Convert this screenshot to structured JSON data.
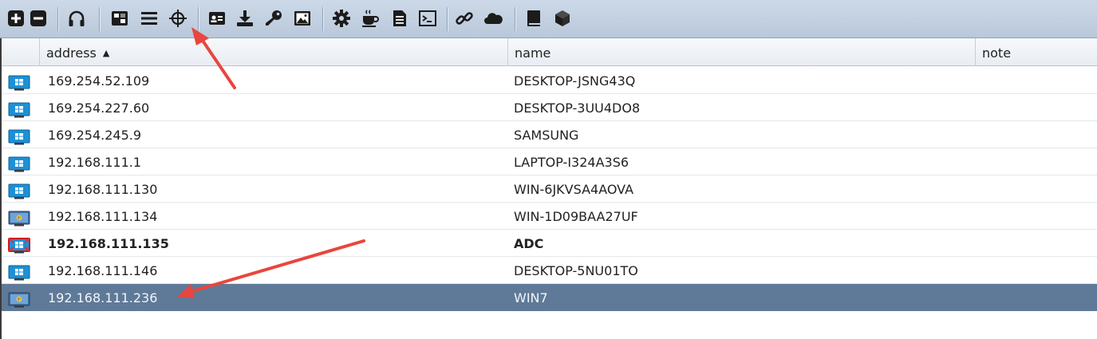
{
  "toolbar": {
    "buttons": [
      {
        "icon": "add-icon"
      },
      {
        "icon": "remove-icon"
      },
      {
        "icon": "headphones-icon"
      },
      {
        "icon": "pivot-graph-icon"
      },
      {
        "icon": "list-icon"
      },
      {
        "icon": "crosshair-icon"
      },
      {
        "icon": "credentials-icon"
      },
      {
        "icon": "download-icon"
      },
      {
        "icon": "key-icon"
      },
      {
        "icon": "image-icon"
      },
      {
        "icon": "gear-icon"
      },
      {
        "icon": "coffee-icon"
      },
      {
        "icon": "document-icon"
      },
      {
        "icon": "terminal-icon"
      },
      {
        "icon": "link-icon"
      },
      {
        "icon": "cloud-icon"
      },
      {
        "icon": "book-icon"
      },
      {
        "icon": "cube-icon"
      }
    ]
  },
  "table": {
    "columns": [
      "address",
      "name",
      "note"
    ],
    "sort_indicator": "▲",
    "rows": [
      {
        "address": "169.254.52.109",
        "name": "DESKTOP-JSNG43Q",
        "icon": "windows10-icon"
      },
      {
        "address": "169.254.227.60",
        "name": "DESKTOP-3UU4DO8",
        "icon": "windows10-icon"
      },
      {
        "address": "169.254.245.9",
        "name": "SAMSUNG",
        "icon": "windows10-icon"
      },
      {
        "address": "192.168.111.1",
        "name": "LAPTOP-I324A3S6",
        "icon": "windows10-icon"
      },
      {
        "address": "192.168.111.130",
        "name": "WIN-6JKVSA4AOVA",
        "icon": "windows10-icon"
      },
      {
        "address": "192.168.111.134",
        "name": "WIN-1D09BAA27UF",
        "icon": "windows7-icon"
      },
      {
        "address": "192.168.111.135",
        "name": "ADC",
        "icon": "windows10-compromised-icon",
        "bold": true
      },
      {
        "address": "192.168.111.146",
        "name": "DESKTOP-5NU01TO",
        "icon": "windows10-icon"
      },
      {
        "address": "192.168.111.236",
        "name": "WIN7",
        "icon": "windows7-icon",
        "selected": true
      }
    ]
  },
  "colors": {
    "toolbar_bg": "#c5d3e4",
    "selected_row": "#5f7a98",
    "annotation_arrow": "#e8463e"
  }
}
